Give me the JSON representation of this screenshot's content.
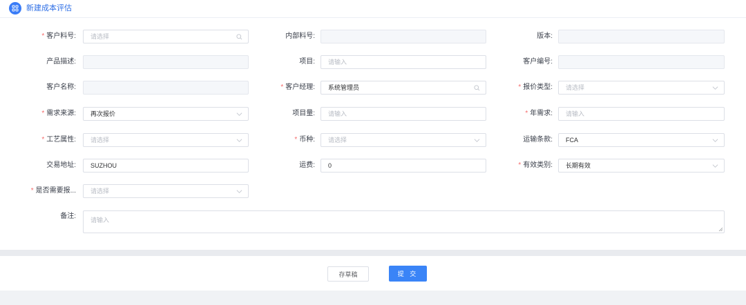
{
  "header": {
    "title": "新建成本评估",
    "icon": "grid-icon"
  },
  "colors": {
    "accent": "#3a84f7",
    "required": "#f56c6c",
    "disabled_bg": "#f5f7fa"
  },
  "form": {
    "customer_part_no": {
      "label": "客户料号:",
      "required": true,
      "placeholder": "请选择",
      "value": ""
    },
    "internal_part_no": {
      "label": "内部料号:",
      "required": false,
      "value": ""
    },
    "version": {
      "label": "版本:",
      "required": false,
      "value": ""
    },
    "product_desc": {
      "label": "产品描述:",
      "required": false,
      "value": ""
    },
    "project": {
      "label": "项目:",
      "required": false,
      "placeholder": "请输入",
      "value": ""
    },
    "customer_code": {
      "label": "客户编号:",
      "required": false,
      "value": ""
    },
    "customer_name": {
      "label": "客户名称:",
      "required": false,
      "value": ""
    },
    "customer_manager": {
      "label": "客户经理:",
      "required": true,
      "value": "系统管理员"
    },
    "quote_type": {
      "label": "报价类型:",
      "required": true,
      "placeholder": "请选择",
      "value": ""
    },
    "demand_source": {
      "label": "需求来源:",
      "required": true,
      "value": "再次报价"
    },
    "project_volume": {
      "label": "项目量:",
      "required": false,
      "placeholder": "请输入",
      "value": ""
    },
    "annual_demand": {
      "label": "年需求:",
      "required": true,
      "placeholder": "请输入",
      "value": ""
    },
    "process_attr": {
      "label": "工艺属性:",
      "required": true,
      "placeholder": "请选择",
      "value": ""
    },
    "currency": {
      "label": "币种:",
      "required": true,
      "placeholder": "请选择",
      "value": ""
    },
    "shipping_terms": {
      "label": "运输条款:",
      "required": false,
      "value": "FCA"
    },
    "trade_address": {
      "label": "交易地址:",
      "required": false,
      "value": "SUZHOU"
    },
    "freight": {
      "label": "运费:",
      "required": false,
      "value": "0"
    },
    "validity_type": {
      "label": "有效类别:",
      "required": true,
      "value": "长期有效"
    },
    "need_quote": {
      "label": "是否需要报...",
      "required": true,
      "placeholder": "请选择",
      "value": ""
    },
    "remarks": {
      "label": "备注:",
      "required": false,
      "placeholder": "请输入",
      "value": ""
    }
  },
  "required_mark": "*",
  "footer": {
    "draft_label": "存草稿",
    "submit_label": "提 交"
  }
}
